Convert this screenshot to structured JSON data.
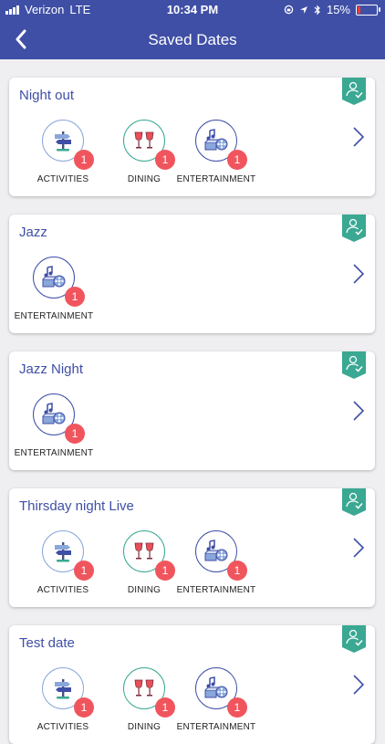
{
  "status_bar": {
    "carrier": "Verizon",
    "network": "LTE",
    "time": "10:34 PM",
    "battery": "15%"
  },
  "header": {
    "title": "Saved Dates"
  },
  "colors": {
    "header_bg": "#3f4fa6",
    "ribbon": "#3aa892",
    "badge": "#f0555d",
    "activities": "#8aa7dc",
    "dining": "#3aa892",
    "entertainment": "#3f4fa6"
  },
  "dates": [
    {
      "title": "Night out",
      "categories": [
        {
          "key": "activities",
          "label": "ACTIVITIES",
          "count": "1",
          "icon": "signpost-icon"
        },
        {
          "key": "dining",
          "label": "DINING",
          "count": "1",
          "icon": "wine-glasses-icon"
        },
        {
          "key": "entertainment",
          "label": "ENTERTAINMENT",
          "count": "1",
          "icon": "music-film-icon"
        }
      ]
    },
    {
      "title": "Jazz",
      "categories": [
        {
          "key": "entertainment",
          "label": "ENTERTAINMENT",
          "count": "1",
          "icon": "music-film-icon"
        }
      ]
    },
    {
      "title": "Jazz Night",
      "categories": [
        {
          "key": "entertainment",
          "label": "ENTERTAINMENT",
          "count": "1",
          "icon": "music-film-icon"
        }
      ]
    },
    {
      "title": "Thirsday night Live",
      "categories": [
        {
          "key": "activities",
          "label": "ACTIVITIES",
          "count": "1",
          "icon": "signpost-icon"
        },
        {
          "key": "dining",
          "label": "DINING",
          "count": "1",
          "icon": "wine-glasses-icon"
        },
        {
          "key": "entertainment",
          "label": "ENTERTAINMENT",
          "count": "1",
          "icon": "music-film-icon"
        }
      ]
    },
    {
      "title": "Test date",
      "categories": [
        {
          "key": "activities",
          "label": "ACTIVITIES",
          "count": "1",
          "icon": "signpost-icon"
        },
        {
          "key": "dining",
          "label": "DINING",
          "count": "1",
          "icon": "wine-glasses-icon"
        },
        {
          "key": "entertainment",
          "label": "ENTERTAINMENT",
          "count": "1",
          "icon": "music-film-icon"
        }
      ]
    }
  ]
}
